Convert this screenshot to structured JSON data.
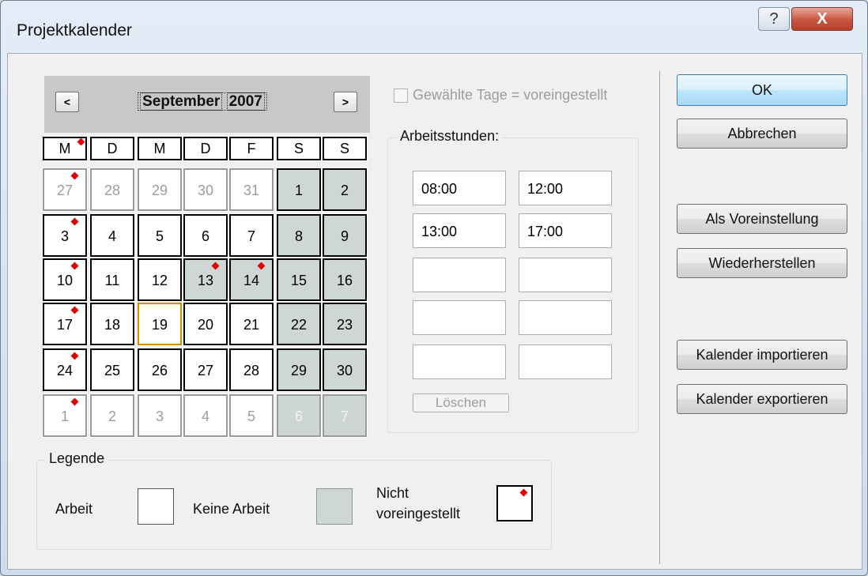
{
  "window": {
    "title": "Projektkalender",
    "help_label": "?",
    "close_label": "X"
  },
  "calendar": {
    "prev_label": "<",
    "next_label": ">",
    "month": "September",
    "year": "2007",
    "weekdays": [
      "M",
      "D",
      "M",
      "D",
      "F",
      "S",
      "S"
    ],
    "weeks": [
      [
        "27",
        "28",
        "29",
        "30",
        "31",
        "1",
        "2"
      ],
      [
        "3",
        "4",
        "5",
        "6",
        "7",
        "8",
        "9"
      ],
      [
        "10",
        "11",
        "12",
        "13",
        "14",
        "15",
        "16"
      ],
      [
        "17",
        "18",
        "19",
        "20",
        "21",
        "22",
        "23"
      ],
      [
        "24",
        "25",
        "26",
        "27",
        "28",
        "29",
        "30"
      ],
      [
        "1",
        "2",
        "3",
        "4",
        "5",
        "6",
        "7"
      ]
    ]
  },
  "options": {
    "default_checkbox_label": "Gewählte Tage = voreingestellt"
  },
  "hours": {
    "title": "Arbeitsstunden:",
    "rows": [
      [
        "08:00",
        "12:00"
      ],
      [
        "13:00",
        "17:00"
      ],
      [
        "",
        ""
      ],
      [
        "",
        ""
      ],
      [
        "",
        ""
      ]
    ],
    "clear_label": "Löschen"
  },
  "legend": {
    "title": "Legende",
    "work_label": "Arbeit",
    "nowork_label": "Keine Arbeit",
    "notdefault_line1": "Nicht",
    "notdefault_line2": "voreingestellt"
  },
  "buttons": {
    "ok": "OK",
    "cancel": "Abbrechen",
    "set_default": "Als Voreinstellung",
    "restore": "Wiederherstellen",
    "import": "Kalender importieren",
    "export": "Kalender exportieren"
  },
  "colors": {
    "nonworking_day": "#cfd7d6",
    "working_day": "#ffffff",
    "marker": "#e00000",
    "today_border": "#d98b00"
  }
}
